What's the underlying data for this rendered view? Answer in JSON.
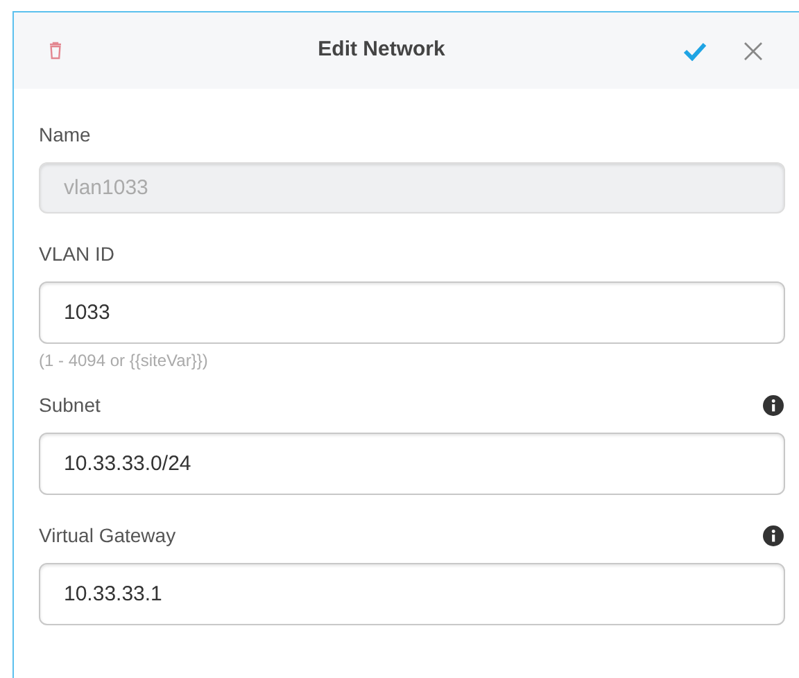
{
  "header": {
    "title": "Edit Network"
  },
  "fields": [
    {
      "label": "Name",
      "value": "vlan1033",
      "disabled": true,
      "info": false
    },
    {
      "label": "VLAN ID",
      "value": "1033",
      "disabled": false,
      "info": false,
      "hint": "(1 - 4094 or {{siteVar}})"
    },
    {
      "label": "Subnet",
      "value": "10.33.33.0/24",
      "disabled": false,
      "info": true
    },
    {
      "label": "Virtual Gateway",
      "value": "10.33.33.1",
      "disabled": false,
      "info": true
    }
  ]
}
